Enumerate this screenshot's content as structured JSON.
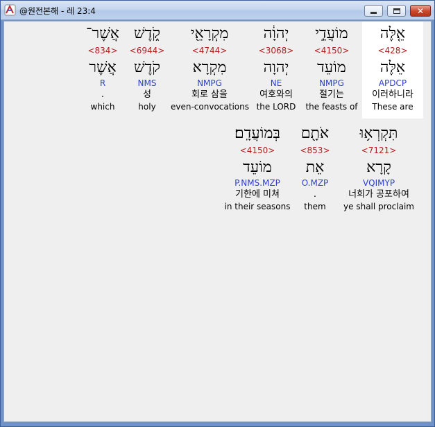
{
  "window": {
    "title": "@원전본해 - 레 23:4",
    "icon": "app-logo-icon",
    "controls": {
      "minimize": "minimize-icon",
      "maximize": "maximize-icon",
      "close": "✕"
    }
  },
  "colors": {
    "strong": "#b02020",
    "morph": "#2d3fd0",
    "highlight_bg": "#ffffff",
    "client_bg": "#efefef"
  },
  "verse_rows": [
    {
      "words": [
        {
          "hebrew": "אֵ֤לֶּה",
          "strong": "<428>",
          "lexeme": "אֵלֶּה",
          "morph": "APDCP",
          "korean": "이러하니라",
          "english": "These are",
          "highlighted": true
        },
        {
          "hebrew": "מוֹעֲדֵ֣י",
          "strong": "<4150>",
          "lexeme": "מוֹעֵד",
          "morph": "NMPG",
          "korean": "절기는",
          "english": "the feasts of",
          "highlighted": false
        },
        {
          "hebrew": "יְהוָ֔ה",
          "strong": "<3068>",
          "lexeme": "יְהוָה",
          "morph": "NE",
          "korean": "여호와의",
          "english": "the LORD",
          "highlighted": false
        },
        {
          "hebrew": "מִקְרָאֵ֖י",
          "strong": "<4744>",
          "lexeme": "מִקְרָא",
          "morph": "NMPG",
          "korean": "회로 삼을",
          "english": "even-convocations",
          "highlighted": false
        },
        {
          "hebrew": "קֹ֑דֶשׁ",
          "strong": "<6944>",
          "lexeme": "קֹדֶשׁ",
          "morph": "NMS",
          "korean": "성",
          "english": "holy",
          "highlighted": false
        },
        {
          "hebrew": "אֲשֶׁר־",
          "strong": "<834>",
          "lexeme": "אֲשֶׁר",
          "morph": "R",
          "korean": ".",
          "english": "which",
          "highlighted": false
        }
      ]
    },
    {
      "words": [
        {
          "hebrew": "תִּקְרְא֥וּ",
          "strong": "<7121>",
          "lexeme": "קָרָא",
          "morph": "VQIMYP",
          "korean": "너희가 공포하여",
          "english": "ye shall proclaim",
          "highlighted": false
        },
        {
          "hebrew": "אֹתָ֖ם",
          "strong": "<853>",
          "lexeme": "אֵת",
          "morph": "O.MZP",
          "korean": ".",
          "english": "them",
          "highlighted": false
        },
        {
          "hebrew": "בְּמוֹעֲדָֽם׃",
          "strong": "<4150>",
          "lexeme": "מוֹעֵד",
          "morph": "P.NMS.MZP",
          "korean": "기한에 미쳐",
          "english": "in their seasons",
          "highlighted": false
        }
      ]
    }
  ]
}
